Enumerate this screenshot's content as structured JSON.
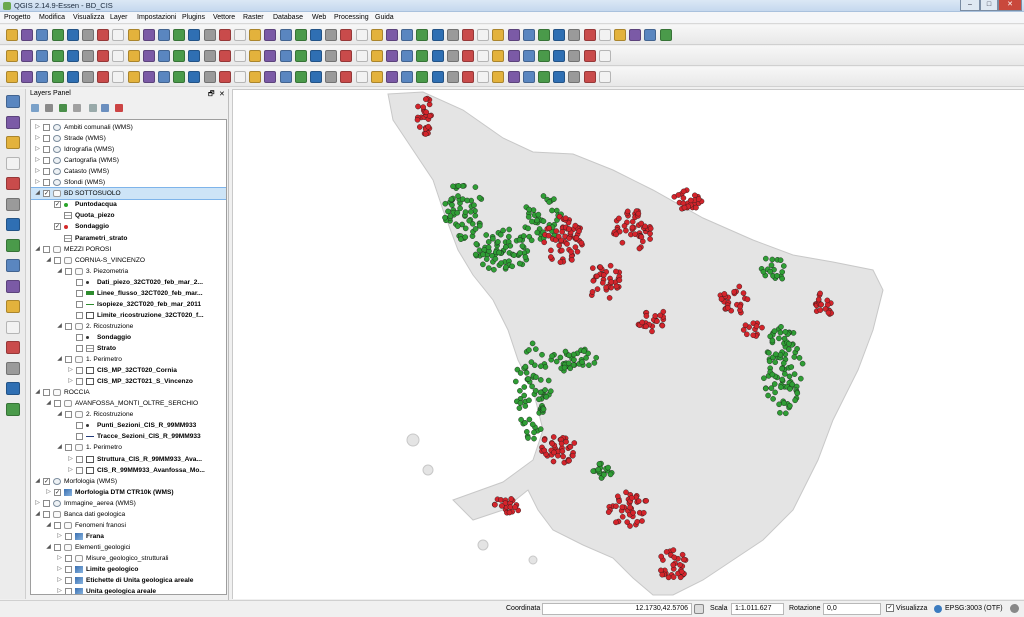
{
  "window": {
    "title": "QGIS 2.14.9-Essen - BD_CIS",
    "minimize": "–",
    "maximize": "□",
    "close": "✕"
  },
  "menu": [
    "Progetto",
    "Modifica",
    "Visualizza",
    "Layer",
    "Impostazioni",
    "Plugins",
    "Vettore",
    "Raster",
    "Database",
    "Web",
    "Processing",
    "Guida"
  ],
  "layers_panel": {
    "title": "Layers Panel",
    "float_btn": "🗗",
    "close_btn": "✕",
    "rows": [
      {
        "label": "Ambiti comunali (WMS)",
        "checked": false,
        "bold": false
      },
      {
        "label": "Strade (WMS)",
        "checked": false,
        "bold": false
      },
      {
        "label": "Idrografia (WMS)",
        "checked": false,
        "bold": false
      },
      {
        "label": "Cartografia (WMS)",
        "checked": false,
        "bold": false
      },
      {
        "label": "Catasto (WMS)",
        "checked": false,
        "bold": false
      },
      {
        "label": "Sfondi (WMS)",
        "checked": false,
        "bold": false
      },
      {
        "label": "BD SOTTOSUOLO",
        "checked": true,
        "bold": false
      },
      {
        "label": "Puntodacqua",
        "checked": true,
        "bold": true
      },
      {
        "label": "Quota_piezo",
        "checked": false,
        "bold": true
      },
      {
        "label": "Sondaggio",
        "checked": true,
        "bold": true
      },
      {
        "label": "Parametri_strato",
        "checked": false,
        "bold": true
      },
      {
        "label": "MEZZI POROSI",
        "checked": false,
        "bold": false
      },
      {
        "label": "CORNIA-S_VINCENZO",
        "checked": false,
        "bold": false
      },
      {
        "label": "3. Piezometria",
        "checked": false,
        "bold": false
      },
      {
        "label": "Dati_piezo_32CT020_feb_mar_2...",
        "checked": false,
        "bold": true
      },
      {
        "label": "Linee_flusso_32CT020_feb_mar...",
        "checked": false,
        "bold": true
      },
      {
        "label": "Isopieze_32CT020_feb_mar_2011",
        "checked": false,
        "bold": true
      },
      {
        "label": "Limite_ricostruzione_32CT020_f...",
        "checked": false,
        "bold": true
      },
      {
        "label": "2. Ricostruzione",
        "checked": false,
        "bold": false
      },
      {
        "label": "Sondaggio",
        "checked": false,
        "bold": true
      },
      {
        "label": "Strato",
        "checked": false,
        "bold": true
      },
      {
        "label": "1. Perimetro",
        "checked": false,
        "bold": false
      },
      {
        "label": "CIS_MP_32CT020_Cornia",
        "checked": false,
        "bold": true
      },
      {
        "label": "CIS_MP_32CT021_S_Vincenzo",
        "checked": false,
        "bold": true
      },
      {
        "label": "ROCCIA",
        "checked": false,
        "bold": false
      },
      {
        "label": "AVANFOSSA_MONTI_OLTRE_SERCHIO",
        "checked": false,
        "bold": false
      },
      {
        "label": "2. Ricostruzione",
        "checked": false,
        "bold": false
      },
      {
        "label": "Punti_Sezioni_CIS_R_99MM933",
        "checked": false,
        "bold": true
      },
      {
        "label": "Tracce_Sezioni_CIS_R_99MM933",
        "checked": false,
        "bold": true
      },
      {
        "label": "1. Perimetro",
        "checked": false,
        "bold": false
      },
      {
        "label": "Struttura_CIS_R_99MM933_Ava...",
        "checked": false,
        "bold": true
      },
      {
        "label": "CIS_R_99MM933_Avanfossa_Mo...",
        "checked": false,
        "bold": true
      },
      {
        "label": "Morfologia (WMS)",
        "checked": true,
        "bold": false
      },
      {
        "label": "Morfologia DTM CTR10k (WMS)",
        "checked": true,
        "bold": true
      },
      {
        "label": "Immagine_aerea (WMS)",
        "checked": false,
        "bold": false
      },
      {
        "label": "Banca dati geologica",
        "checked": false,
        "bold": false
      },
      {
        "label": "Fenomeni franosi",
        "checked": false,
        "bold": false
      },
      {
        "label": "Frana",
        "checked": false,
        "bold": true
      },
      {
        "label": "Elementi_geologici",
        "checked": false,
        "bold": false
      },
      {
        "label": "Misure_geologico_strutturali",
        "checked": false,
        "bold": false
      },
      {
        "label": "Limite geologico",
        "checked": false,
        "bold": true
      },
      {
        "label": "Etichette di Unita geologica areale",
        "checked": false,
        "bold": true
      },
      {
        "label": "Unita geologica areale",
        "checked": false,
        "bold": true
      }
    ]
  },
  "map": {
    "land_color": "#e4e4e4",
    "green": "#2f9e35",
    "red": "#d4242b"
  },
  "status": {
    "coord_label": "Coordinata",
    "coord_value": "12.1730,42.5706",
    "scale_label": "Scala",
    "scale_value": "1:1.011.627",
    "rotation_label": "Rotazione",
    "rotation_value": "0,0",
    "render_label": "Visualizza",
    "crs": "EPSG:3003 (OTF)"
  }
}
